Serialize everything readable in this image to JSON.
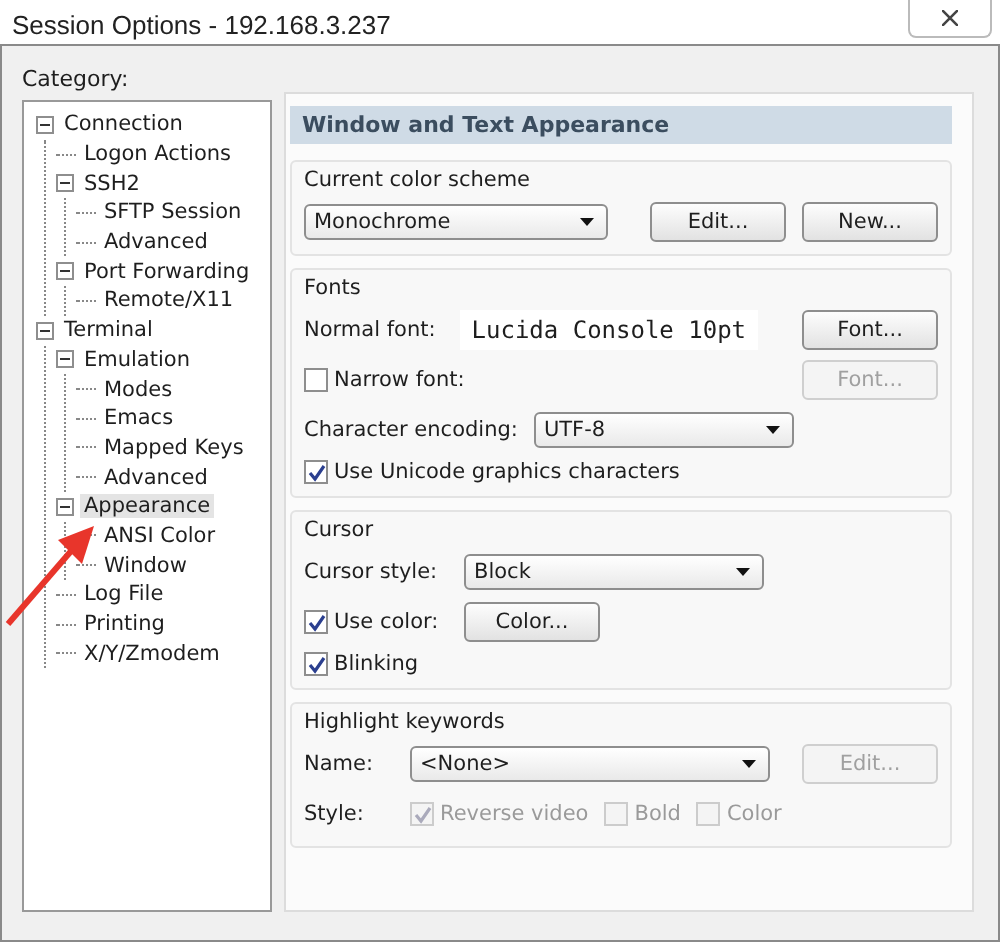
{
  "window": {
    "title": "Session Options - 192.168.3.237"
  },
  "category_label": "Category:",
  "tree": [
    {
      "label": "Connection",
      "expanded": true,
      "selected": false,
      "children": [
        {
          "label": "Logon Actions",
          "selected": false
        },
        {
          "label": "SSH2",
          "expanded": true,
          "selected": false,
          "children": [
            {
              "label": "SFTP Session",
              "selected": false
            },
            {
              "label": "Advanced",
              "selected": false
            }
          ]
        },
        {
          "label": "Port Forwarding",
          "expanded": true,
          "selected": false,
          "children": [
            {
              "label": "Remote/X11",
              "selected": false
            }
          ]
        }
      ]
    },
    {
      "label": "Terminal",
      "expanded": true,
      "selected": false,
      "children": [
        {
          "label": "Emulation",
          "expanded": true,
          "selected": false,
          "children": [
            {
              "label": "Modes",
              "selected": false
            },
            {
              "label": "Emacs",
              "selected": false
            },
            {
              "label": "Mapped Keys",
              "selected": false
            },
            {
              "label": "Advanced",
              "selected": false
            }
          ]
        },
        {
          "label": "Appearance",
          "expanded": true,
          "selected": true,
          "children": [
            {
              "label": "ANSI Color",
              "selected": false
            },
            {
              "label": "Window",
              "selected": false
            }
          ]
        },
        {
          "label": "Log File",
          "selected": false
        },
        {
          "label": "Printing",
          "selected": false
        },
        {
          "label": "X/Y/Zmodem",
          "selected": false
        }
      ]
    }
  ],
  "panel_title": "Window and Text Appearance",
  "color_scheme": {
    "title": "Current color scheme",
    "dropdown": "Monochrome",
    "buttons": [
      {
        "label": "Edit...",
        "disabled": false
      },
      {
        "label": "New...",
        "disabled": false
      }
    ]
  },
  "fonts": {
    "title": "Fonts",
    "normal_font_label": "Normal font:",
    "normal_font_value": "Lucida Console 10pt",
    "normal_font_button": {
      "label": "Font...",
      "disabled": false
    },
    "narrow_font": {
      "label": "Narrow font:",
      "checked": false
    },
    "narrow_font_button": {
      "label": "Font...",
      "disabled": true
    },
    "encoding_label": "Character encoding:",
    "encoding": "UTF-8",
    "unicode": {
      "label": "Use Unicode graphics characters",
      "checked": true
    }
  },
  "cursor": {
    "title": "Cursor",
    "style_label": "Cursor style:",
    "style": "Block",
    "use_color": {
      "label": "Use color:",
      "checked": true
    },
    "color_button": {
      "label": "Color...",
      "disabled": false
    },
    "blinking": {
      "label": "Blinking",
      "checked": true
    }
  },
  "highlight": {
    "title": "Highlight keywords",
    "name_label": "Name:",
    "name": "<None>",
    "edit_button": {
      "label": "Edit...",
      "disabled": true
    },
    "style_label": "Style:",
    "styles": [
      {
        "label": "Reverse video",
        "checked": true,
        "disabled": true
      },
      {
        "label": "Bold",
        "checked": false,
        "disabled": true
      },
      {
        "label": "Color",
        "checked": false,
        "disabled": true
      }
    ]
  }
}
